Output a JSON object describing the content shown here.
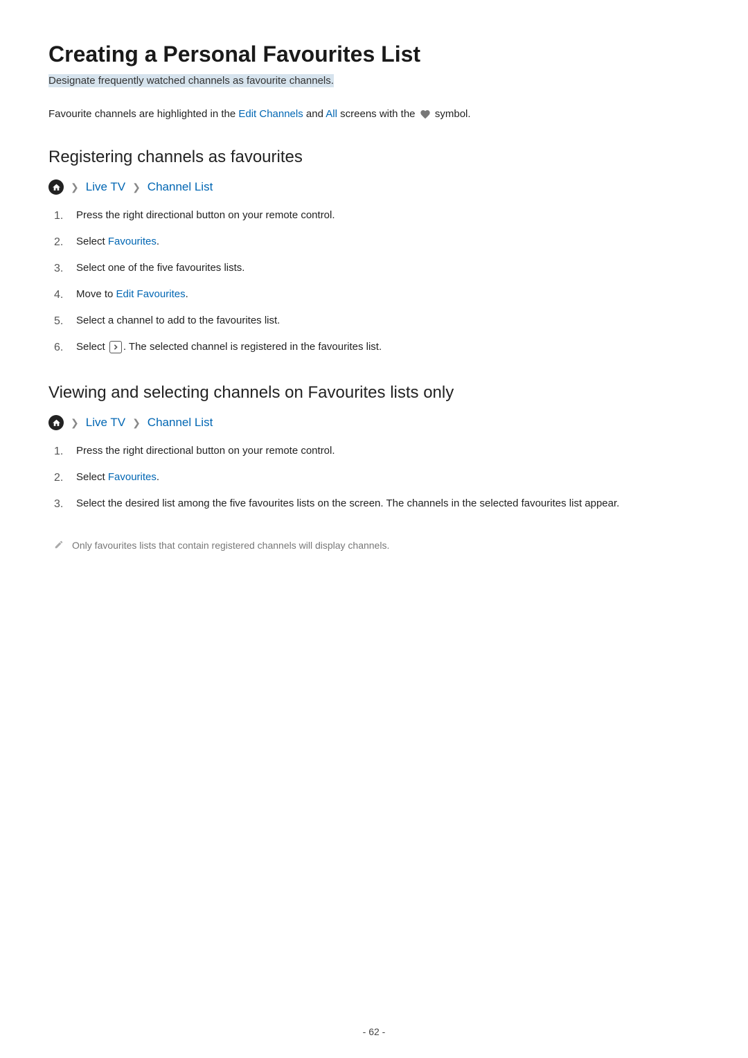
{
  "title": "Creating a Personal Favourites List",
  "subtitle": "Designate frequently watched channels as favourite channels.",
  "intro": {
    "prefix": "Favourite channels are highlighted in the ",
    "link1": "Edit Channels",
    "mid": " and ",
    "link2": "All",
    "suffix": " screens with the ",
    "suffix2": " symbol."
  },
  "section1": {
    "heading": "Registering channels as favourites",
    "breadcrumb": {
      "item1": "Live TV",
      "item2": "Channel List"
    },
    "steps": {
      "s1": "Press the right directional button on your remote control.",
      "s2_prefix": "Select ",
      "s2_link": "Favourites",
      "s2_suffix": ".",
      "s3": "Select one of the five favourites lists.",
      "s4_prefix": "Move to ",
      "s4_link": "Edit Favourites",
      "s4_suffix": ".",
      "s5": "Select a channel to add to the favourites list.",
      "s6_prefix": "Select ",
      "s6_suffix": ". The selected channel is registered in the favourites list."
    }
  },
  "section2": {
    "heading": "Viewing and selecting channels on Favourites lists only",
    "breadcrumb": {
      "item1": "Live TV",
      "item2": "Channel List"
    },
    "steps": {
      "s1": "Press the right directional button on your remote control.",
      "s2_prefix": "Select ",
      "s2_link": "Favourites",
      "s2_suffix": ".",
      "s3": "Select the desired list among the five favourites lists on the screen. The channels in the selected favourites list appear."
    },
    "note": "Only favourites lists that contain registered channels will display channels."
  },
  "pageNumber": "- 62 -"
}
